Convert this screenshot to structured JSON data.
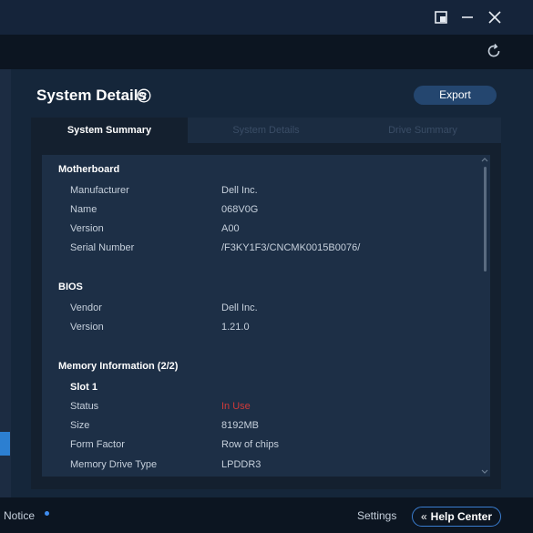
{
  "window": {
    "controls": [
      "pip-icon",
      "minimize-icon",
      "close-icon"
    ]
  },
  "page": {
    "title": "System Details",
    "export_label": "Export"
  },
  "tabs": [
    {
      "label": "System Summary",
      "active": true
    },
    {
      "label": "System Details",
      "active": false
    },
    {
      "label": "Drive Summary",
      "active": false
    }
  ],
  "sections": {
    "motherboard": {
      "title": "Motherboard",
      "rows": [
        {
          "label": "Manufacturer",
          "value": "Dell Inc."
        },
        {
          "label": "Name",
          "value": "068V0G"
        },
        {
          "label": "Version",
          "value": "A00"
        },
        {
          "label": "Serial Number",
          "value": "/F3KY1F3/CNCMK0015B0076/"
        }
      ]
    },
    "bios": {
      "title": "BIOS",
      "rows": [
        {
          "label": "Vendor",
          "value": "Dell Inc."
        },
        {
          "label": "Version",
          "value": "1.21.0"
        }
      ]
    },
    "memory": {
      "title": "Memory Information (2/2)",
      "slot": "Slot 1",
      "rows": [
        {
          "label": "Status",
          "value": "In Use"
        },
        {
          "label": "Size",
          "value": "8192MB"
        },
        {
          "label": "Form Factor",
          "value": "Row of chips"
        },
        {
          "label": "Memory Drive Type",
          "value": "LPDDR3"
        }
      ]
    }
  },
  "footer": {
    "notice": "Notice",
    "settings": "Settings",
    "help_center": "Help Center",
    "help_center_icon": "«"
  },
  "colors": {
    "accent": "#2c7fd1",
    "status_in_use": "#d03a3a"
  }
}
